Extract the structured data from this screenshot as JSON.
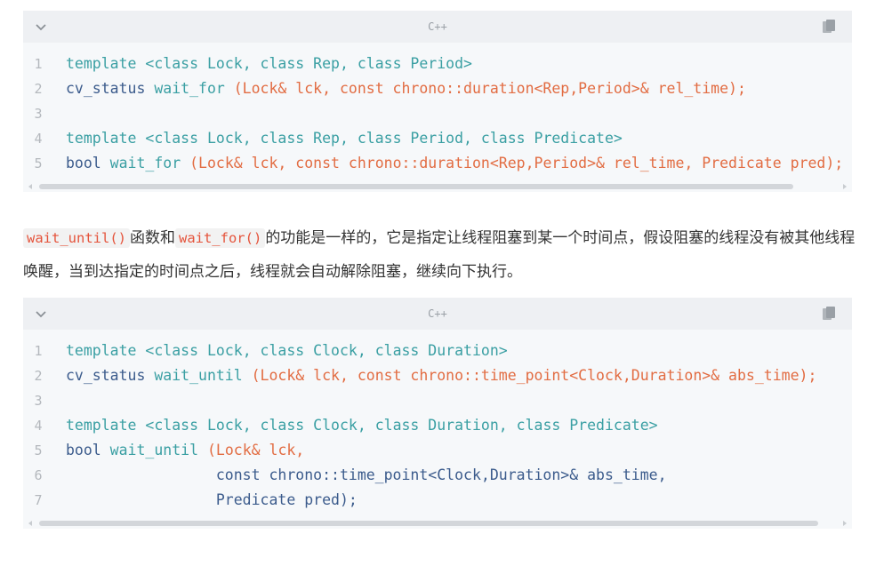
{
  "block1": {
    "lang": "C++",
    "lines": [
      {
        "n": "1",
        "parts": [
          {
            "t": "template",
            "c": "kw"
          },
          {
            "t": " <class Lock, class Rep, class Period>",
            "c": "kw"
          }
        ]
      },
      {
        "n": "2",
        "parts": [
          {
            "t": "cv_status",
            "c": "type"
          },
          {
            "t": " wait_for ",
            "c": "fn"
          },
          {
            "t": "(Lock& lck, const chrono::duration<Rep,Period>& rel_time);",
            "c": "args"
          }
        ]
      },
      {
        "n": "3",
        "parts": []
      },
      {
        "n": "4",
        "parts": [
          {
            "t": "template",
            "c": "kw"
          },
          {
            "t": " <class Lock, class Rep, class Period, class Predicate>",
            "c": "kw"
          }
        ]
      },
      {
        "n": "5",
        "parts": [
          {
            "t": "bool",
            "c": "type"
          },
          {
            "t": " wait_for ",
            "c": "fn"
          },
          {
            "t": "(Lock& lck, const chrono::duration<Rep,Period>& rel_time, Predicate pred);",
            "c": "args"
          }
        ]
      }
    ]
  },
  "paragraph": {
    "code1": "wait_until()",
    "text1": "函数和",
    "code2": "wait_for()",
    "text2": "的功能是一样的，它是指定让线程阻塞到某一个时间点，假设阻塞的线程没有被其他线程唤醒，当到达指定的时间点之后，线程就会自动解除阻塞，继续向下执行。"
  },
  "block2": {
    "lang": "C++",
    "lines": [
      {
        "n": "1",
        "parts": [
          {
            "t": "template",
            "c": "kw"
          },
          {
            "t": " <class Lock, class Clock, class Duration>",
            "c": "kw"
          }
        ]
      },
      {
        "n": "2",
        "parts": [
          {
            "t": "cv_status",
            "c": "type"
          },
          {
            "t": " wait_until ",
            "c": "fn"
          },
          {
            "t": "(Lock& lck, const chrono::time_point<Clock,Duration>& abs_time);",
            "c": "args"
          }
        ]
      },
      {
        "n": "3",
        "parts": []
      },
      {
        "n": "4",
        "parts": [
          {
            "t": "template",
            "c": "kw"
          },
          {
            "t": " <class Lock, class Clock, class Duration, class Predicate>",
            "c": "kw"
          }
        ]
      },
      {
        "n": "5",
        "parts": [
          {
            "t": "bool",
            "c": "type"
          },
          {
            "t": " wait_until ",
            "c": "fn"
          },
          {
            "t": "(Lock& lck,",
            "c": "args"
          }
        ]
      },
      {
        "n": "6",
        "parts": [
          {
            "t": "                 const chrono::time_point<Clock,Duration>& abs_time,",
            "c": "type"
          }
        ]
      },
      {
        "n": "7",
        "parts": [
          {
            "t": "                 Predicate pred);",
            "c": "type"
          }
        ]
      }
    ]
  },
  "icons": {
    "collapse": "chevron-down-icon",
    "copy": "copy-icon"
  }
}
